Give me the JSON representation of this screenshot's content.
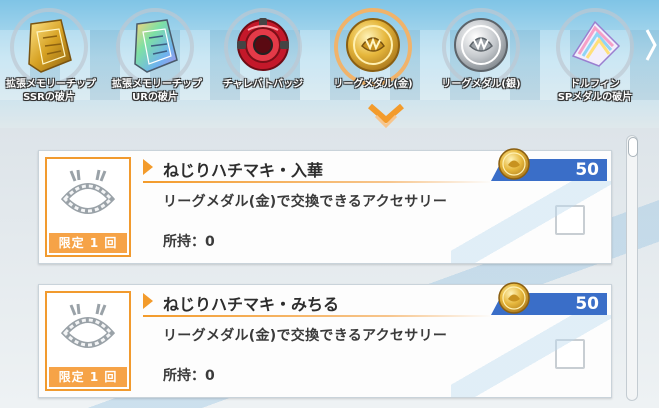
{
  "categories": [
    {
      "label": "拡張メモリーチップ\nSSRの破片",
      "icon": "gold-memory-chip-icon",
      "selected": false
    },
    {
      "label": "拡張メモリーチップ\nURの破片",
      "icon": "rainbow-memory-chip-icon",
      "selected": false
    },
    {
      "label": "チャレバトバッジ",
      "icon": "red-badge-icon",
      "selected": false
    },
    {
      "label": "リーグメダル(金)",
      "icon": "gold-medal-icon",
      "selected": true
    },
    {
      "label": "リーグメダル(銀)",
      "icon": "silver-medal-icon",
      "selected": false
    },
    {
      "label": "ドルフィン\nSPメダルの破片",
      "icon": "dolphin-sp-medal-icon",
      "selected": false
    }
  ],
  "items": [
    {
      "title": "ねじりハチマキ・入華",
      "price": "50",
      "description": "リーグメダル(金)で交換できるアクセサリー",
      "owned": "所持：0",
      "limit": "限定 1 回",
      "icon": "twisted-headband-icon",
      "currency_icon": "gold-medal-icon",
      "checked": false
    },
    {
      "title": "ねじりハチマキ・みちる",
      "price": "50",
      "description": "リーグメダル(金)で交換できるアクセサリー",
      "owned": "所持：0",
      "limit": "限定 1 回",
      "icon": "twisted-headband-icon",
      "currency_icon": "gold-medal-icon",
      "checked": false
    }
  ],
  "colors": {
    "accent": "#f39b2b",
    "price_bg": "#3a6ec8",
    "limit_bg": "#f6a347"
  }
}
